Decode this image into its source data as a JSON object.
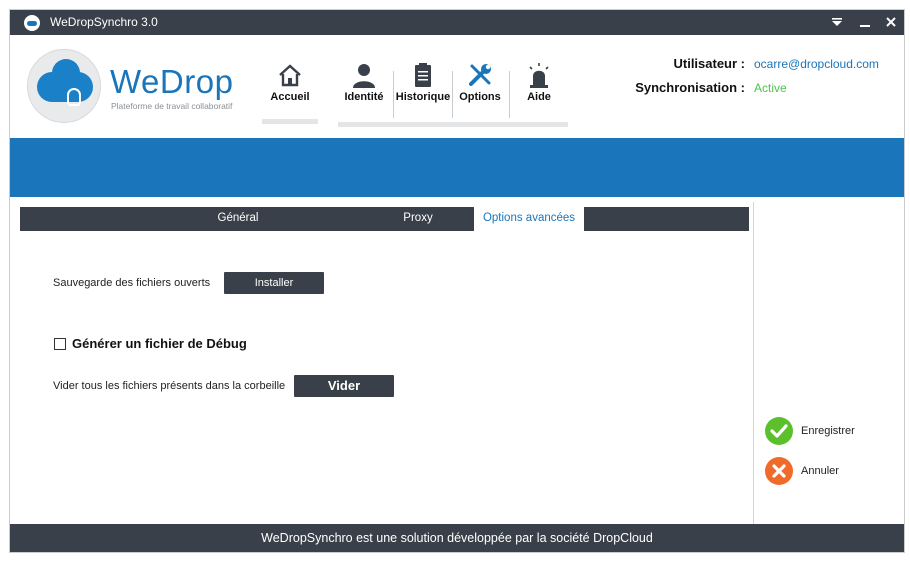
{
  "window": {
    "title": "WeDropSynchro 3.0",
    "icons": {
      "menu": "menu-down-icon",
      "minimize": "minimize-icon",
      "close": "close-icon"
    }
  },
  "brand": {
    "name": "WeDrop",
    "tagline": "Plateforme de travail collaboratif",
    "color": "#1a75bb"
  },
  "nav": {
    "home": {
      "label": "Accueil",
      "icon": "home-icon"
    },
    "items": [
      {
        "label": "Identité",
        "icon": "user-icon"
      },
      {
        "label": "Historique",
        "icon": "clipboard-icon"
      },
      {
        "label": "Options",
        "icon": "tools-icon"
      },
      {
        "label": "Aide",
        "icon": "alarm-light-icon"
      }
    ]
  },
  "account": {
    "user_label": "Utilisateur :",
    "user_value": "ocarre@dropcloud.com",
    "sync_label": "Synchronisation :",
    "sync_value": "Active",
    "sync_color": "#4cc54a"
  },
  "tabs": {
    "items": [
      "Général",
      "Proxy",
      "Options avancées"
    ],
    "active": "Options avancées"
  },
  "advanced": {
    "backup_label": "Sauvegarde des fichiers ouverts",
    "install_button": "Installer",
    "debug_label": "Générer un fichier de Débug",
    "debug_checked": false,
    "trash_label": "Vider tous les fichiers présents dans la corbeille",
    "empty_button": "Vider"
  },
  "actions": {
    "save": {
      "label": "Enregistrer",
      "icon": "check-icon",
      "color": "#5cc02c"
    },
    "cancel": {
      "label": "Annuler",
      "icon": "cross-icon",
      "color": "#f06a2a"
    }
  },
  "footer": {
    "text": "WeDropSynchro est une solution développée par la société DropCloud"
  },
  "colors": {
    "dark": "#3a4049",
    "accent": "#1a75bb"
  }
}
